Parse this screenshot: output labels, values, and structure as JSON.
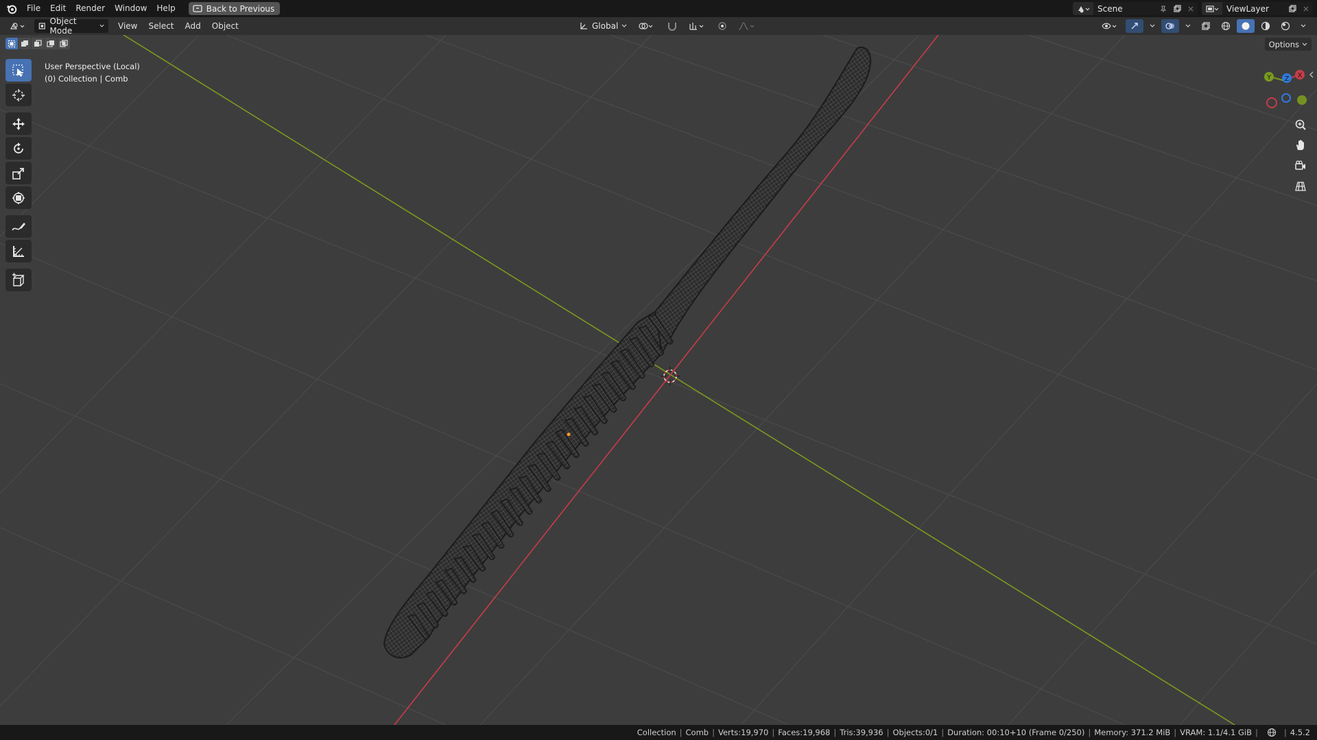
{
  "topbar": {
    "menus": [
      "File",
      "Edit",
      "Render",
      "Window",
      "Help"
    ],
    "back_button": "Back to Previous",
    "scene_name": "Scene",
    "view_layer": "ViewLayer"
  },
  "header": {
    "mode": "Object Mode",
    "menus": [
      "View",
      "Select",
      "Add",
      "Object"
    ],
    "transform_orientation": "Global",
    "options_label": "Options"
  },
  "viewport": {
    "perspective_label": "User Perspective (Local)",
    "collection_label": "(0) Collection | Comb",
    "axis_colors": {
      "x": "#c83c4a",
      "y": "#7b9b1e",
      "z": "#2f7ae0"
    },
    "gizmo_labels": {
      "x": "X",
      "y": "Y",
      "z": "Z"
    }
  },
  "toolbar": {
    "tools": [
      "select-box",
      "cursor",
      "move",
      "rotate",
      "scale",
      "transform",
      "annotate",
      "measure",
      "add-cube"
    ]
  },
  "statusbar": {
    "collection": "Collection",
    "object": "Comb",
    "verts": "Verts:19,970",
    "faces": "Faces:19,968",
    "tris": "Tris:39,936",
    "objects": "Objects:0/1",
    "duration": "Duration: 00:10+10 (Frame 0/250)",
    "memory": "Memory: 371.2 MiB",
    "vram": "VRAM: 1.1/4.1 GiB",
    "version": "4.5.2"
  }
}
